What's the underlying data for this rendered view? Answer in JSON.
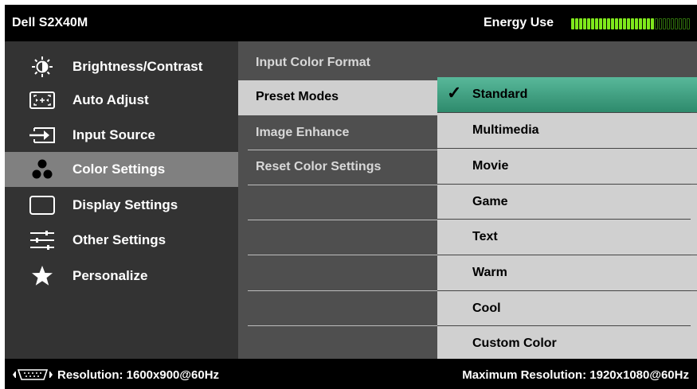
{
  "header": {
    "model": "Dell S2X40M",
    "energy_label": "Energy Use",
    "energy_level": 0.7
  },
  "menu": [
    {
      "id": "brightness",
      "label": "Brightness/Contrast",
      "icon": "brightness-icon"
    },
    {
      "id": "auto-adjust",
      "label": "Auto Adjust",
      "icon": "auto-adjust-icon"
    },
    {
      "id": "input-source",
      "label": "Input Source",
      "icon": "input-source-icon"
    },
    {
      "id": "color-settings",
      "label": "Color Settings",
      "icon": "color-settings-icon",
      "active": true
    },
    {
      "id": "display-settings",
      "label": "Display Settings",
      "icon": "display-icon"
    },
    {
      "id": "other-settings",
      "label": "Other Settings",
      "icon": "sliders-icon"
    },
    {
      "id": "personalize",
      "label": "Personalize",
      "icon": "star-icon"
    }
  ],
  "submenu": [
    {
      "label": "Input Color Format"
    },
    {
      "label": "Preset Modes",
      "active": true
    },
    {
      "label": "Image Enhance"
    },
    {
      "label": "Reset Color Settings"
    }
  ],
  "options": [
    {
      "label": "Standard",
      "selected": true
    },
    {
      "label": "Multimedia"
    },
    {
      "label": "Movie"
    },
    {
      "label": "Game"
    },
    {
      "label": "Text"
    },
    {
      "label": "Warm"
    },
    {
      "label": "Cool"
    },
    {
      "label": "Custom Color"
    }
  ],
  "footer": {
    "resolution": "Resolution: 1600x900@60Hz",
    "max_resolution": "Maximum Resolution: 1920x1080@60Hz"
  },
  "colors": {
    "accent": "#3ea884",
    "energy_on": "#7fe81c",
    "energy_off": "#2f6f0c"
  }
}
